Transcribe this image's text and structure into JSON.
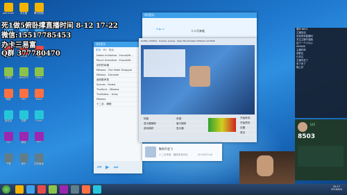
{
  "overlay": {
    "line1": "死1做5俯卧撑直播时间 8-12 17-22",
    "line2": "微信:15517785453",
    "line3": "办卡三易富",
    "line4": "Q群 377780470"
  },
  "desktop_icons": [
    {
      "label": "Administr"
    },
    {
      "label": "QQ互联"
    },
    {
      "label": "文档"
    },
    {
      "label": "计算机"
    },
    {
      "label": "网络"
    },
    {
      "label": "回收站"
    },
    {
      "label": "QQ"
    },
    {
      "label": "下载"
    },
    {
      "label": "浏览器"
    },
    {
      "label": "360"
    },
    {
      "label": "Xshell"
    },
    {
      "label": "WinSCP"
    },
    {
      "label": "OBS"
    },
    {
      "label": "录屏"
    },
    {
      "label": "微信"
    },
    {
      "label": "音乐"
    },
    {
      "label": "腾讯视频"
    },
    {
      "label": "迅雷"
    },
    {
      "label": "百度"
    },
    {
      "label": "Office"
    },
    {
      "label": "Word"
    },
    {
      "label": "Excel"
    },
    {
      "label": "PPT"
    },
    {
      "label": "控制面板"
    }
  ],
  "music_player": {
    "title": "QQ音乐",
    "tabs": [
      "歌单",
      "MV",
      "电台"
    ],
    "songs": [
      "Faded Unlimited - Franz&Mi...",
      "Pencil Unlimited - Franz&Mi...",
      "说好的幸福",
      "Mikolas - The Fader Dropgue",
      "Mikolas - Fairytale",
      "我的歌声里",
      "Scenes - Faded",
      "Thaifunk - Mikolas",
      "TheFather - Unity",
      "Mikolas",
      "十二月 - 情歌"
    ],
    "now_playing": "十二月来临 · 晨阳未来乐队",
    "mini_title": "聚到不会飞",
    "time": "00:00/03:40"
  },
  "obs_window": {
    "title": "Profile: Untitled - Scenes: scenes - Open Broadcaster Software v0.659b",
    "scenes": [
      "场景",
      "显示器捕获",
      "游戏捕获"
    ],
    "sources": [
      "来源",
      "窗口捕获",
      "显示器"
    ],
    "buttons": [
      "开始串流",
      "开始预览",
      "设置",
      "退出"
    ]
  },
  "top_player": {
    "title": "QQ音乐",
    "song": "十二月来临"
  },
  "chat": {
    "header": "观众:6811",
    "messages": [
      "主播加油",
      "欢迎来到直播间",
      "关注主播不迷路",
      "送了一个小心心",
      "666666",
      "主播好帅",
      "求歌名",
      "已关注",
      "主播辛苦了",
      "来了来了",
      "晚上好"
    ],
    "score": "8503",
    "level": "LV5"
  },
  "clock": {
    "time": "20:17",
    "date": "2018/6/4"
  },
  "colors": {
    "accent": "#3fa0ea",
    "desktop": "#1f79cf",
    "taskbar": "#1a2f4d"
  }
}
